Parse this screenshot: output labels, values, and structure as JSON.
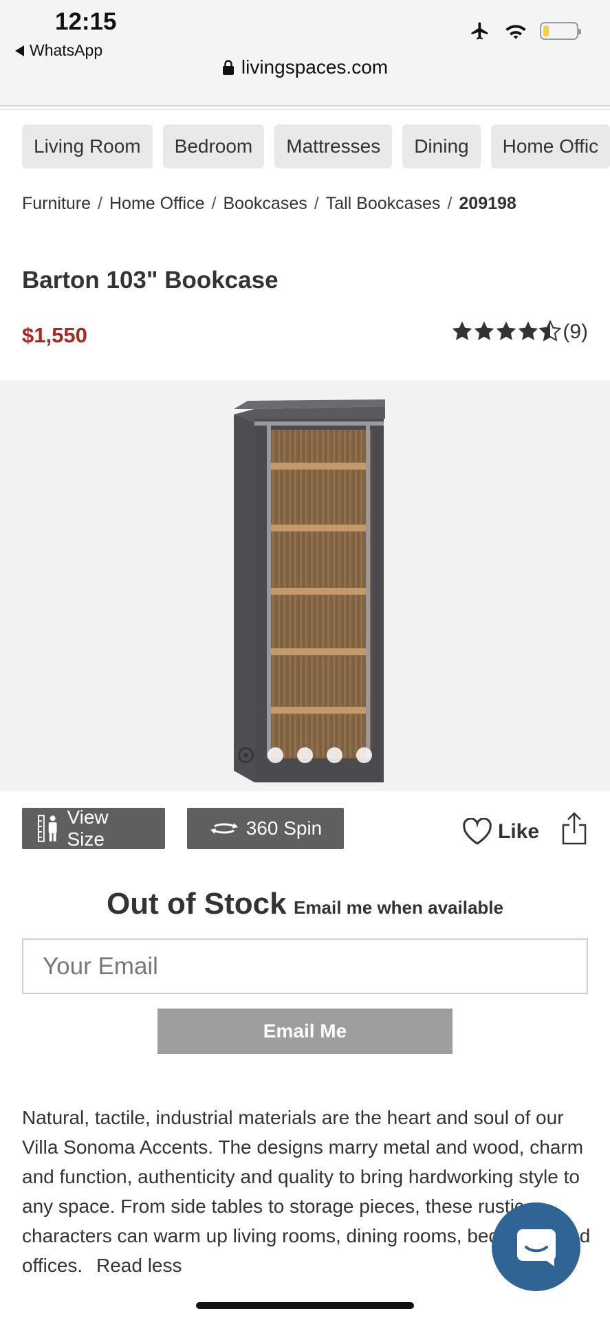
{
  "status_bar": {
    "time": "12:15",
    "back_app": "WhatsApp",
    "url": "livingspaces.com",
    "icons": [
      "airplane-icon",
      "wifi-icon",
      "battery-icon"
    ]
  },
  "categories": [
    {
      "label": "Living Room"
    },
    {
      "label": "Bedroom"
    },
    {
      "label": "Mattresses"
    },
    {
      "label": "Dining"
    },
    {
      "label": "Home Offic"
    }
  ],
  "breadcrumb": {
    "items": [
      "Furniture",
      "Home Office",
      "Bookcases",
      "Tall Bookcases"
    ],
    "current": "209198",
    "separator": "/"
  },
  "product": {
    "title": "Barton 103\" Bookcase",
    "price": "$1,550",
    "rating": {
      "stars": 4.5,
      "count_text": "(9)"
    },
    "image_count": 5,
    "active_image": 1
  },
  "actions": {
    "view_size": "View Size",
    "spin": "360 Spin",
    "like": "Like"
  },
  "stock": {
    "status": "Out of Stock",
    "notify": "Email me when available",
    "email_placeholder": "Your Email",
    "email_button": "Email Me"
  },
  "description": {
    "text": "Natural, tactile, industrial materials are the heart and soul of our Villa Sonoma Accents. The designs marry metal and wood, charm and function, authenticity and quality to bring hardworking style to any space. From side tables to storage pieces, these rustic characters can warm up living rooms, dining rooms, bedrooms and offices.",
    "toggle": "Read less"
  },
  "colors": {
    "price": "#a42a23",
    "chat_bubble": "#2f6494",
    "button_dark": "#5f5f5f",
    "button_disabled": "#9e9e9e"
  }
}
